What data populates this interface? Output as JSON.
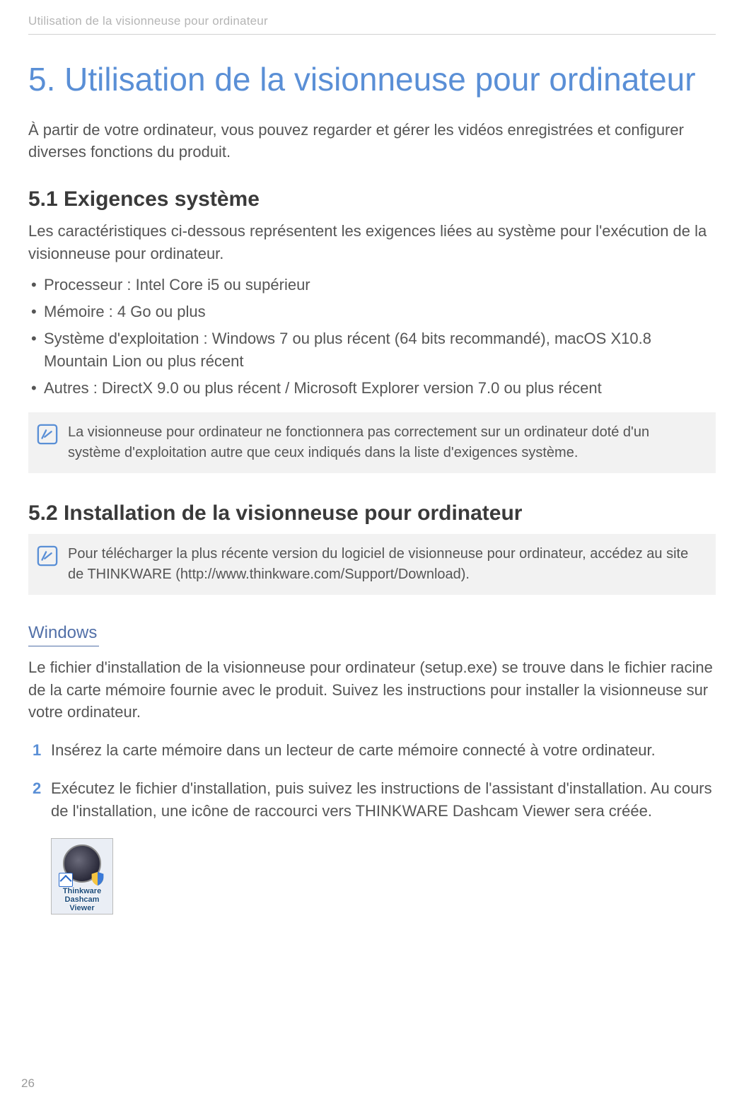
{
  "page": {
    "running_header": "Utilisation de la visionneuse pour ordinateur",
    "chapter_title": "5.  Utilisation de la visionneuse pour ordinateur",
    "intro": "À partir de votre ordinateur, vous pouvez regarder et gérer les vidéos enregistrées et configurer diverses fonctions du produit.",
    "page_number": "26"
  },
  "section51": {
    "title": "5.1   Exigences système",
    "intro": "Les caractéristiques ci-dessous représentent les exigences liées au système pour l'exécution de la visionneuse pour ordinateur.",
    "bullets": [
      "Processeur : Intel Core i5 ou supérieur",
      "Mémoire : 4 Go ou plus",
      "Système d'exploitation : Windows 7 ou plus récent (64 bits recommandé), macOS X10.8 Mountain Lion ou plus récent",
      "Autres : DirectX 9.0 ou plus récent / Microsoft Explorer version 7.0 ou plus récent"
    ],
    "note": "La visionneuse pour ordinateur ne fonctionnera pas correctement sur un ordinateur doté d'un système d'exploitation autre que ceux indiqués dans la liste d'exigences système."
  },
  "section52": {
    "title": "5.2   Installation de la visionneuse pour ordinateur",
    "note": "Pour télécharger la plus récente version du logiciel de visionneuse pour ordinateur, accédez au site de THINKWARE (http://www.thinkware.com/Support/Download).",
    "windows_title": "Windows",
    "windows_intro": "Le fichier d'installation de la visionneuse pour ordinateur (setup.exe) se trouve dans le fichier racine de la carte mémoire fournie avec le produit. Suivez les instructions pour installer la visionneuse sur votre ordinateur.",
    "steps": [
      "Insérez la carte mémoire dans un lecteur de carte mémoire connecté à votre ordinateur.",
      "Exécutez le fichier d'installation, puis suivez les instructions de l'assistant d'installation. Au cours de l'installation, une icône de raccourci vers THINKWARE Dashcam Viewer sera créée."
    ],
    "step_nums": [
      "1",
      "2"
    ],
    "shortcut_label_line1": "Thinkware",
    "shortcut_label_line2": "Dashcam",
    "shortcut_label_line3": "Viewer"
  }
}
